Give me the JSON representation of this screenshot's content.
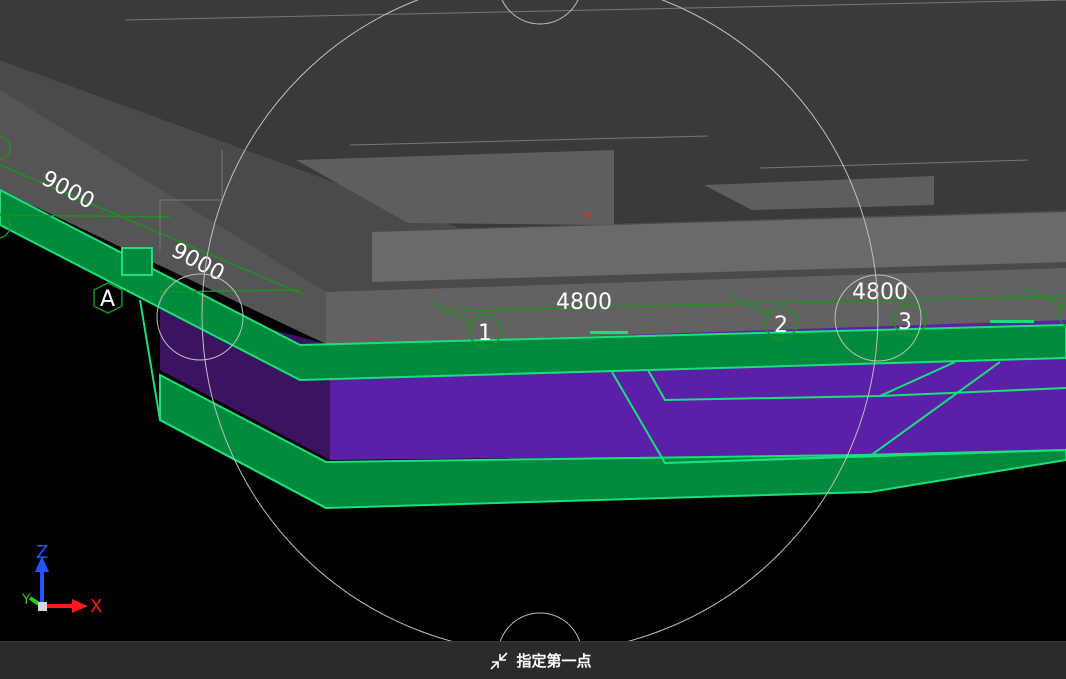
{
  "viewport": {
    "dimensions": [
      {
        "id": "dim-9000-a",
        "text": "9000"
      },
      {
        "id": "dim-9000-b",
        "text": "9000"
      },
      {
        "id": "dim-4800-a",
        "text": "4800"
      },
      {
        "id": "dim-4800-b",
        "text": "4800"
      }
    ],
    "grid_bubbles": [
      {
        "id": "grid-a",
        "text": "A"
      },
      {
        "id": "grid-1",
        "text": "1"
      },
      {
        "id": "grid-2",
        "text": "2"
      },
      {
        "id": "grid-3",
        "text": "3"
      }
    ],
    "axis_triad": {
      "x_label": "X",
      "y_label": "Y",
      "z_label": "Z"
    },
    "colors": {
      "slab_top": "#3a3a3a",
      "beam_gray": "#666666",
      "green_fill": "#008a3e",
      "green_edge": "#19e07a",
      "purple": "#5c1fa8",
      "grid_line": "#1f8f1f",
      "axis_x": "#ff1a1a",
      "axis_y": "#22cc22",
      "axis_z": "#2255ff"
    }
  },
  "command_bar": {
    "prompt": "指定第一点",
    "icon": "select-point-icon"
  }
}
